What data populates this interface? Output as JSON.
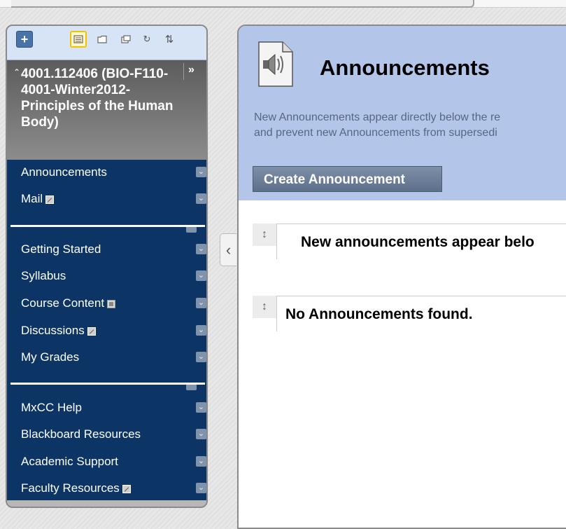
{
  "toolbar": {
    "buttons": [
      "add-icon",
      "list-view-icon",
      "folder-view-icon",
      "new-window-icon",
      "refresh-icon",
      "reorder-icon"
    ],
    "glyphs": {
      "add": "+",
      "refresh": "↻",
      "sort": "⇅"
    }
  },
  "course": {
    "collapse_glyph": "⌃",
    "title": "4001.112406 (BIO-F110-4001-Winter2012-Principles of the Human Body)",
    "expand_glyph": "»"
  },
  "menu": {
    "groups": [
      [
        {
          "label": "Announcements",
          "icon": null
        },
        {
          "label": "Mail",
          "icon": "tool-link-icon"
        }
      ],
      [
        {
          "label": "Getting Started",
          "icon": null
        },
        {
          "label": "Syllabus",
          "icon": null
        },
        {
          "label": "Course Content",
          "icon": "content-area-icon"
        },
        {
          "label": "Discussions",
          "icon": "tool-link-icon"
        },
        {
          "label": "My Grades",
          "icon": null
        }
      ],
      [
        {
          "label": "MxCC Help",
          "icon": null
        },
        {
          "label": "Blackboard Resources",
          "icon": null
        },
        {
          "label": "Academic Support",
          "icon": null
        },
        {
          "label": "Faculty Resources",
          "icon": "tool-link-icon"
        }
      ]
    ],
    "collapse_glyph": "‹",
    "chevron_glyph": "⌄"
  },
  "content": {
    "title": "Announcements",
    "description_lines": [
      "New Announcements appear directly below the re",
      "and prevent new Announcements from supersedi"
    ],
    "create_button": "Create Announcement",
    "drag_glyph": "↕",
    "announcements": [
      "New announcements appear belo",
      "No Announcements found."
    ]
  },
  "colors": {
    "menu_bg": "#0c3566",
    "header_bg": "#b3c6ea",
    "toolbar_bg": "#d7e4f5",
    "button_bg": "#6d7f99",
    "course_header_bg": "#707070"
  }
}
